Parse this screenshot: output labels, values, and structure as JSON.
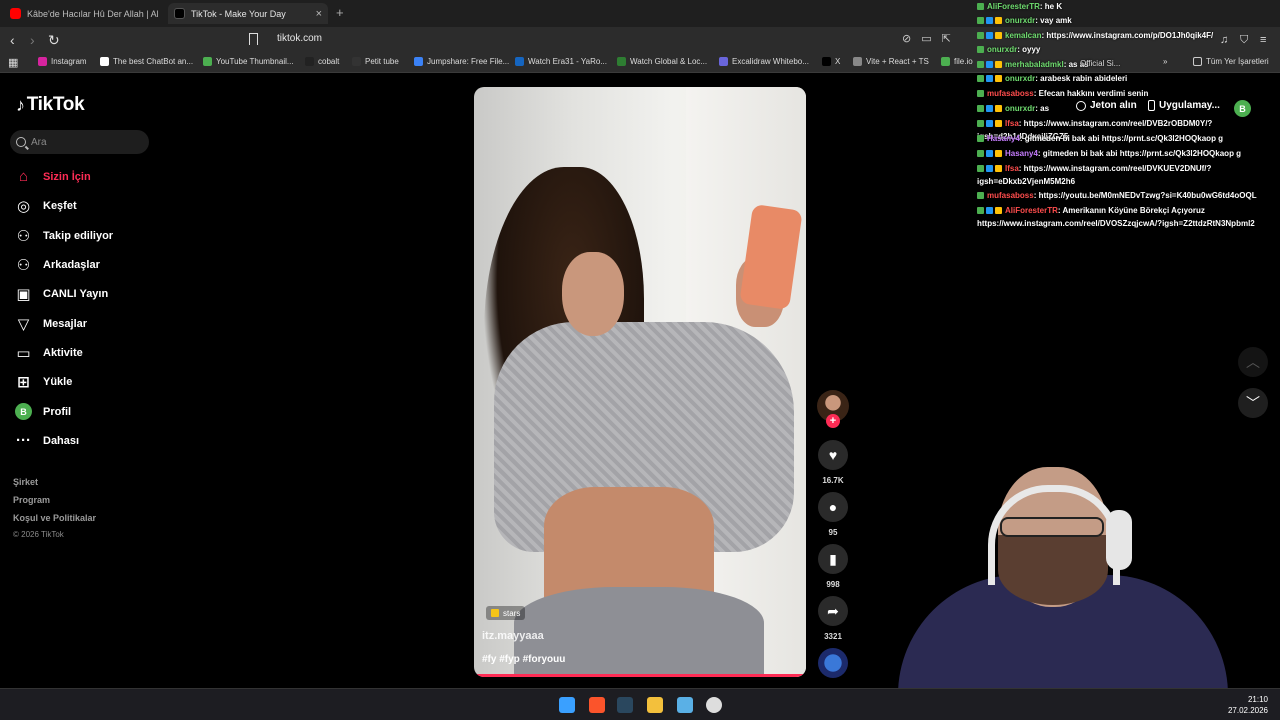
{
  "browser": {
    "tabs": [
      {
        "title": "Kâbe'de Hacılar Hû Der Allah | Abdur",
        "active": false,
        "favicon_color": "#ff0000"
      },
      {
        "title": "TikTok - Make Your Day",
        "active": true,
        "favicon_color": "#000000"
      }
    ],
    "close_symbol": "×",
    "new_tab_symbol": "+",
    "url": "tiktok.com",
    "bookmarks": [
      {
        "label": "Instagram",
        "icon": "instagram-icon",
        "color": "#d6249f"
      },
      {
        "label": "The best ChatBot an...",
        "icon": "chatbot-icon",
        "color": "#ffffff"
      },
      {
        "label": "YouTube Thumbnail...",
        "icon": "thumbnail-icon",
        "color": "#4caf50"
      },
      {
        "label": "cobalt",
        "icon": "cobalt-icon",
        "color": "#222222"
      },
      {
        "label": "Petit tube",
        "icon": "petit-tube-icon",
        "color": "#333333"
      },
      {
        "label": "Jumpshare: Free File...",
        "icon": "jumpshare-icon",
        "color": "#3b82f6"
      },
      {
        "label": "Watch Era31 - YaRo...",
        "icon": "watch-icon",
        "color": "#1565c0"
      },
      {
        "label": "Watch Global & Loc...",
        "icon": "watch-global-icon",
        "color": "#2e7d32"
      },
      {
        "label": "Excalidraw Whitebo...",
        "icon": "excalidraw-icon",
        "color": "#6965db"
      },
      {
        "label": "X",
        "icon": "x-icon",
        "color": "#000000"
      },
      {
        "label": "Vite + React + TS",
        "icon": "vite-icon",
        "color": "#888888"
      },
      {
        "label": "file.io",
        "icon": "fileio-icon",
        "color": "#4caf50"
      }
    ],
    "more_bookmarks_symbol": "»",
    "all_bookmarks": "Tüm Yer İşaretleri"
  },
  "tiktok": {
    "logo": "TikTok",
    "search_placeholder": "Ara",
    "nav": [
      {
        "label": "Sizin İçin",
        "icon": "home-icon",
        "glyph": "⌂",
        "active": true
      },
      {
        "label": "Keşfet",
        "icon": "compass-icon",
        "glyph": "◎",
        "active": false
      },
      {
        "label": "Takip ediliyor",
        "icon": "user-plus-icon",
        "glyph": "⚇",
        "active": false
      },
      {
        "label": "Arkadaşlar",
        "icon": "friends-icon",
        "glyph": "⚇",
        "active": false
      },
      {
        "label": "CANLI Yayın",
        "icon": "live-icon",
        "glyph": "▣",
        "active": false
      },
      {
        "label": "Mesajlar",
        "icon": "message-icon",
        "glyph": "▽",
        "active": false
      },
      {
        "label": "Aktivite",
        "icon": "activity-icon",
        "glyph": "▭",
        "active": false
      },
      {
        "label": "Yükle",
        "icon": "upload-icon",
        "glyph": "⊞",
        "active": false
      },
      {
        "label": "Profil",
        "icon": "profile-avatar-icon",
        "glyph": "B",
        "active": false
      },
      {
        "label": "Dahası",
        "icon": "more-icon",
        "glyph": "···",
        "active": false
      }
    ],
    "footer": [
      "Şirket",
      "Program",
      "Koşul ve Politikalar"
    ],
    "copyright": "© 2026 TikTok",
    "top_right": {
      "coins": "Jeton alın",
      "app": "Uygulamay...",
      "avatar_letter": "B"
    },
    "video": {
      "badge": "stars",
      "username": "itz.mayyaaa",
      "hashtags": "#fy #fyp #foryouu",
      "progress_fraction": 1.0,
      "progress_color": "#fe2c55"
    },
    "actions": {
      "follow_symbol": "+",
      "likes": "16.7K",
      "comments": "95",
      "saves": "998",
      "shares": "3321"
    },
    "accent": "#fe2c55"
  },
  "chat": [
    {
      "user": "AliForesterTR",
      "color": "#6fdc6f",
      "msg": ": he K"
    },
    {
      "user": "onurxdr",
      "color": "#6fdc6f",
      "msg": ": vay amk"
    },
    {
      "user": "kemalcan",
      "color": "#6fdc6f",
      "msg": ": https://www.instagram.com/p/DO1Jh0qik4F/"
    },
    {
      "user": "onurxdr",
      "color": "#6fdc6f",
      "msg": ": oyyy"
    },
    {
      "user": "merhabaladmkl",
      "color": "#6fdc6f",
      "msg": ": as as"
    },
    {
      "user": "onurxdr",
      "color": "#6fdc6f",
      "msg": ": arabesk rabin abideleri"
    },
    {
      "user": "mufasaboss",
      "color": "#ff4d4d",
      "msg": ": Efecan hakkını verdimi senin"
    },
    {
      "user": "onurxdr",
      "color": "#6fdc6f",
      "msg": ": as"
    },
    {
      "user": "Ifsa",
      "color": "#ff4d4d",
      "msg": ": https://www.instagram.com/reel/DVB2rOBDM0Y/?igsh=d2h1dDdxejljZGZ5"
    },
    {
      "user": "Hasany4",
      "color": "#c77dff",
      "msg": ": gitmeden bi bak abi https://prnt.sc/Qk3l2HOQkaop g"
    },
    {
      "user": "Hasany4",
      "color": "#c77dff",
      "msg": ": gitmeden bi bak abi https://prnt.sc/Qk3l2HOQkaop g"
    },
    {
      "user": "Ifsa",
      "color": "#ff4d4d",
      "msg": ": https://www.instagram.com/reel/DVKUEV2DNUf/?igsh=eDkxb2VjenM5M2h6"
    },
    {
      "user": "mufasaboss",
      "color": "#ff4d4d",
      "msg": ": https://youtu.be/M0mNEDvTzwg?si=K40bu0wG6td4oOQL"
    },
    {
      "user": "AliForesterTR",
      "color": "#ff4d4d",
      "msg": ": Amerikanın Köyüne Börekçi Açıyoruz https://www.instagram.com/reel/DVOSZzqjcwA/?igsh=Z2ttdzRtN3Npbml2"
    }
  ],
  "bookmark_overlay_text": "Official Si...",
  "taskbar": {
    "apps": [
      {
        "name": "windows-start-icon",
        "color": "#3aa0ff"
      },
      {
        "name": "brave-browser-icon",
        "color": "#fb542b"
      },
      {
        "name": "steam-icon",
        "color": "#2a475e"
      },
      {
        "name": "file-explorer-icon",
        "color": "#f3c03c"
      },
      {
        "name": "photos-icon",
        "color": "#5ab0e6"
      },
      {
        "name": "obs-icon",
        "color": "#dddddd"
      }
    ],
    "time": "21:10",
    "date": "27.02.2026"
  }
}
